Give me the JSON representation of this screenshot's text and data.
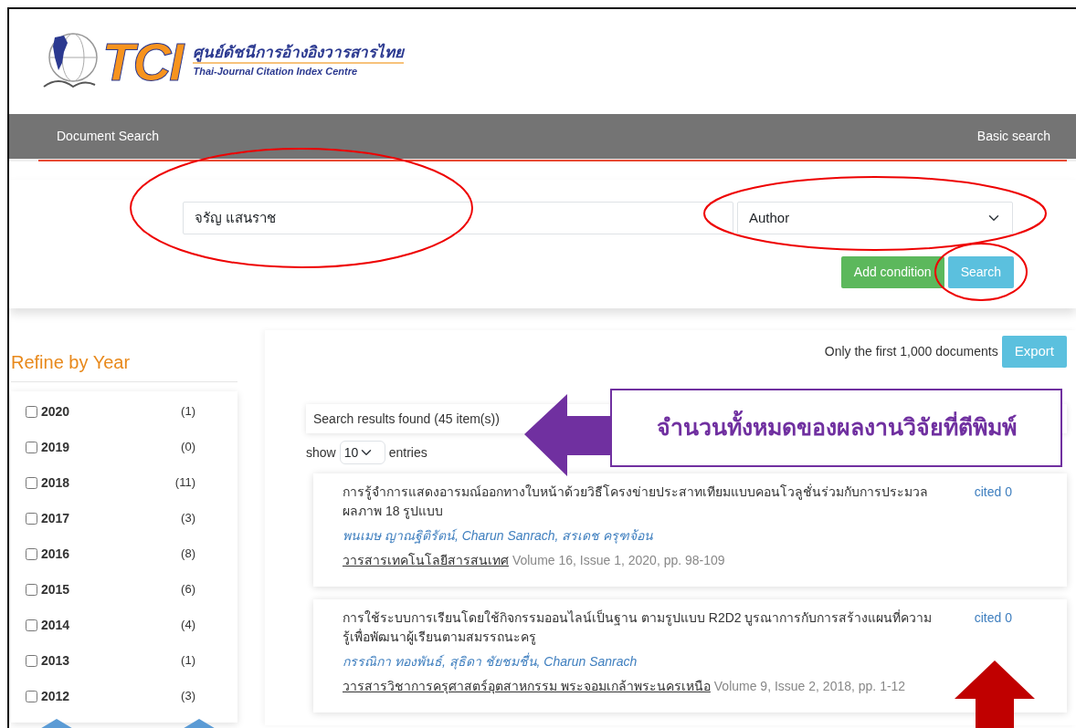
{
  "header": {
    "logo_mark": "TCI",
    "logo_title_th": "ศูนย์ดัชนีการอ้างอิงวารสารไทย",
    "logo_title_en": "Thai-Journal Citation Index Centre"
  },
  "navbar": {
    "left": "Document Search",
    "right": "Basic search"
  },
  "search": {
    "query": "จรัญ แสนราช",
    "field": "Author",
    "buttons": [
      {
        "label": "Add condition",
        "kind": "success"
      },
      {
        "label": "Search",
        "kind": "info"
      }
    ]
  },
  "refine": {
    "title": "Refine by Year",
    "years": [
      {
        "year": "2020",
        "count": "(1)",
        "checked": false
      },
      {
        "year": "2019",
        "count": "(0)",
        "checked": false
      },
      {
        "year": "2018",
        "count": "(11)",
        "checked": false
      },
      {
        "year": "2017",
        "count": "(3)",
        "checked": false
      },
      {
        "year": "2016",
        "count": "(8)",
        "checked": false
      },
      {
        "year": "2015",
        "count": "(6)",
        "checked": false
      },
      {
        "year": "2014",
        "count": "(4)",
        "checked": false
      },
      {
        "year": "2013",
        "count": "(1)",
        "checked": false
      },
      {
        "year": "2012",
        "count": "(3)",
        "checked": false
      }
    ]
  },
  "results": {
    "limit_note": "Only the first 1,000 documents",
    "export": "Export",
    "found": "Search results found (45 item(s))",
    "show": "show",
    "page_size": "10",
    "entries": "entries",
    "items": [
      {
        "title": "การรู้จำการแสดงอารมณ์ออกทางใบหน้าด้วยวิธีโครงข่ายประสาทเทียมแบบคอนโวลูชั่นร่วมกับการประมวลผลภาพ 18 รูปแบบ",
        "authors": "พนเมษ ญาณฐิติรัตน์, Charun Sanrach, สรเดช ครุฑจ้อน",
        "journal": "วารสารเทคโนโลยีสารสนเทศ",
        "details": "Volume 16, Issue 1, 2020, pp. 98-109",
        "cited": "cited 0"
      },
      {
        "title": "การใช้ระบบการเรียนโดยใช้กิจกรรมออนไลน์เป็นฐาน ตามรูปแบบ R2D2 บูรณาการกับการสร้างแผนที่ความรู้เพื่อพัฒนาผู้เรียนตามสมรรถนะครู",
        "authors": "กรรณิกา ทองพันธ์, สุธิดา ชัยชมชื่น, Charun Sanrach",
        "journal": "วารสารวิชาการครุศาสตร์อุตสาหกรรม พระจอมเกล้าพระนครเหนือ",
        "details": "Volume 9, Issue 2, 2018, pp. 1-12",
        "cited": "cited 0"
      }
    ]
  },
  "annotation": {
    "callout": "จำนวนทั้งหมดของผลงานวิจัยที่ตีพิมพ์"
  }
}
